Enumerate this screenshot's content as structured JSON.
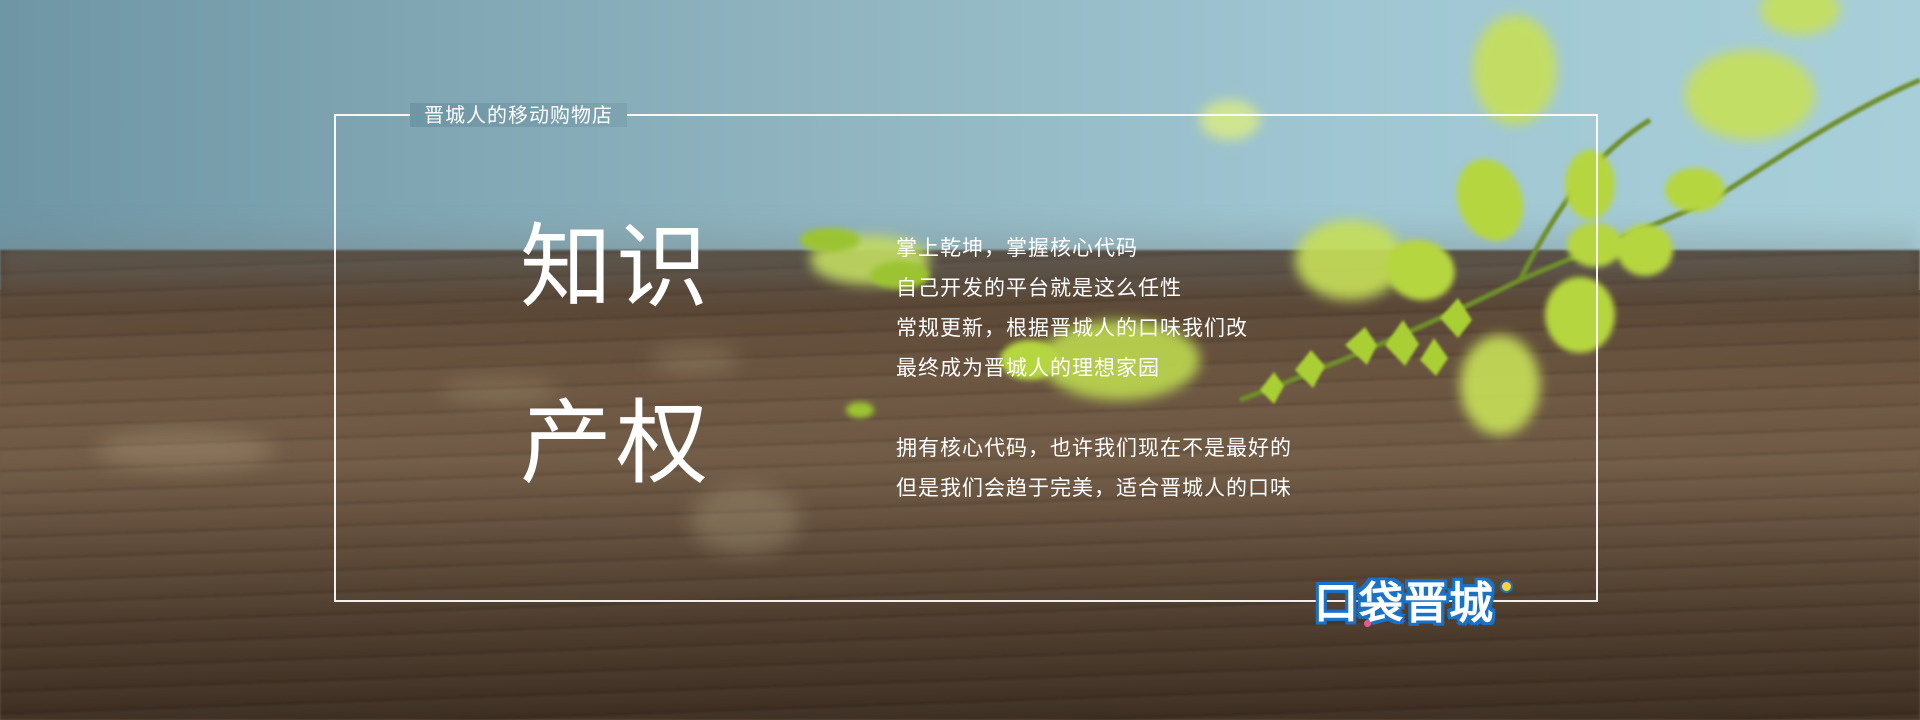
{
  "banner": {
    "caption": "晋城人的移动购物店",
    "headline_1": "知识",
    "headline_2": "产权",
    "paragraph_1": [
      "掌上乾坤，掌握核心代码",
      "自己开发的平台就是这么任性",
      "常规更新，根据晋城人的口味我们改",
      "最终成为晋城人的理想家园"
    ],
    "paragraph_2": [
      "拥有核心代码，也许我们现在不是最好的",
      "但是我们会趋于完美，适合晋城人的口味"
    ],
    "logo_text": "口袋晋城"
  },
  "colors": {
    "sky": "#9fc6d2",
    "table": "#6a543f",
    "leaf": "#b8d84a",
    "logo_blue": "#1a72c8",
    "text": "#ffffff"
  },
  "icons": {
    "background": "blurred-leaves-on-wooden-table",
    "logo": "koudai-jincheng-logo"
  }
}
